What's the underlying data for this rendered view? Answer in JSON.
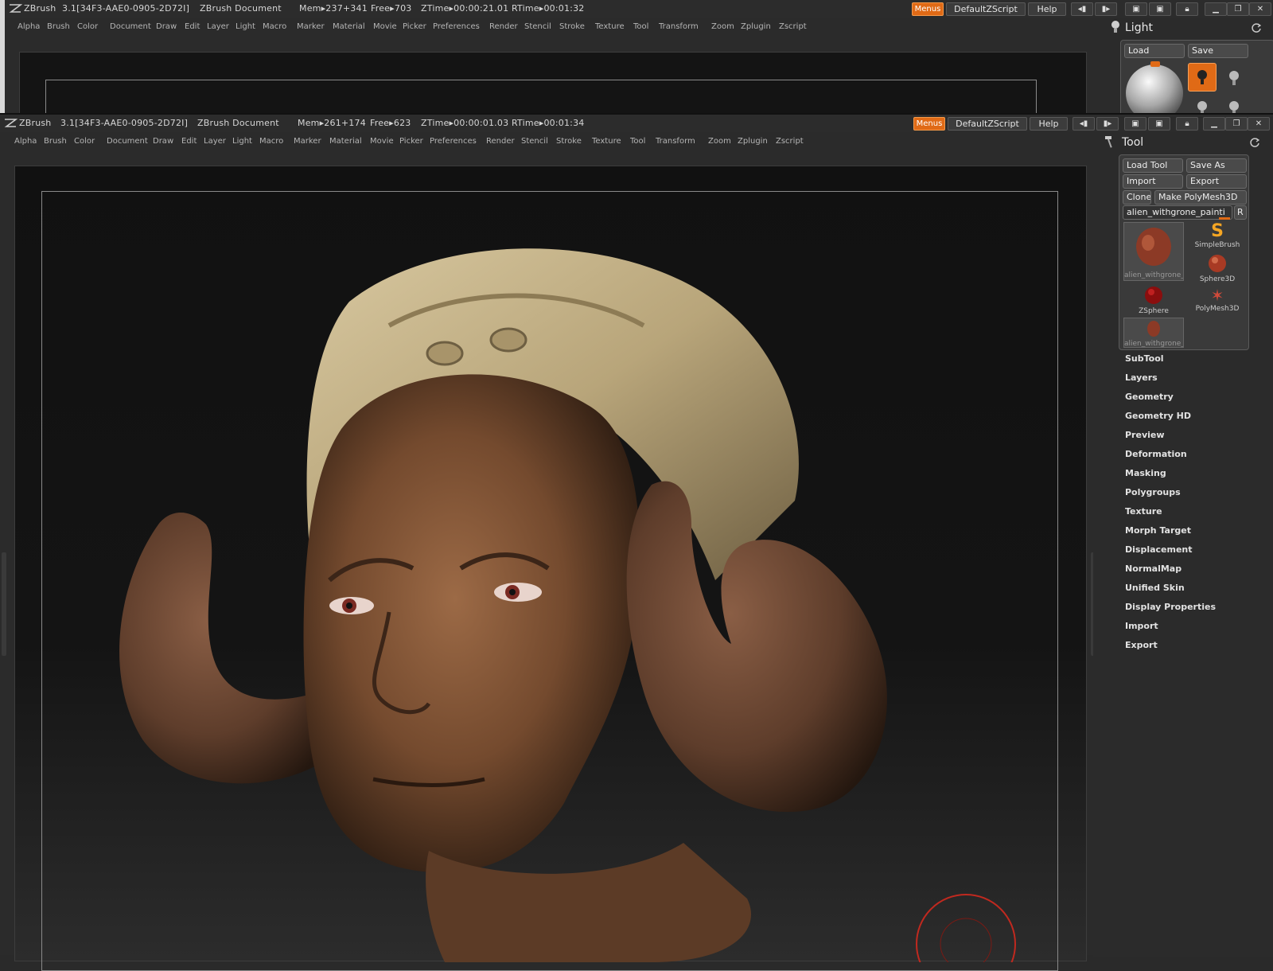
{
  "back_window": {
    "app": "ZBrush",
    "version": "3.1[34F3-AAE0-0905-2D72I]",
    "doc": "ZBrush Document",
    "mem": "Mem▸237+341",
    "free": "Free▸703",
    "ztime": "ZTime▸00:00:21.01",
    "rtime": "RTime▸00:01:32",
    "menus_label": "Menus",
    "zscript_label": "DefaultZScript",
    "help_label": "Help",
    "panel_title": "Light",
    "load_label": "Load",
    "save_label": "Save"
  },
  "front_window": {
    "app": "ZBrush",
    "version": "3.1[34F3-AAE0-0905-2D72I]",
    "doc": "ZBrush Document",
    "mem": "Mem▸261+174",
    "free": "Free▸623",
    "ztime": "ZTime▸00:00:01.03",
    "rtime": "RTime▸00:01:34",
    "menus_label": "Menus",
    "zscript_label": "DefaultZScript",
    "help_label": "Help"
  },
  "menus": [
    "Alpha",
    "Brush",
    "Color",
    "Document",
    "Draw",
    "Edit",
    "Layer",
    "Light",
    "Macro",
    "Marker",
    "Material",
    "Movie",
    "Picker",
    "Preferences",
    "Render",
    "Stencil",
    "Stroke",
    "Texture",
    "Tool",
    "Transform",
    "Zoom",
    "Zplugin",
    "Zscript"
  ],
  "tool_panel": {
    "title": "Tool",
    "load_tool": "Load Tool",
    "save_as": "Save As",
    "import": "Import",
    "export": "Export",
    "clone": "Clone",
    "make_polymesh": "Make PolyMesh3D",
    "current_tool": "alien_withgrone_painti",
    "r_label": "R",
    "thumbs": [
      "alien_withgrone_",
      "SimpleBrush",
      "Sphere3D",
      "ZSphere",
      "PolyMesh3D",
      "alien_withgrone_"
    ],
    "subpalettes": [
      "SubTool",
      "Layers",
      "Geometry",
      "Geometry HD",
      "Preview",
      "Deformation",
      "Masking",
      "Polygroups",
      "Texture",
      "Morph Target",
      "Displacement",
      "NormalMap",
      "Unified Skin",
      "Display Properties",
      "Import",
      "Export"
    ]
  },
  "colors": {
    "accent": "#e06a16",
    "canvas_bg": "#141414",
    "ui_bg": "#2b2b2b"
  }
}
